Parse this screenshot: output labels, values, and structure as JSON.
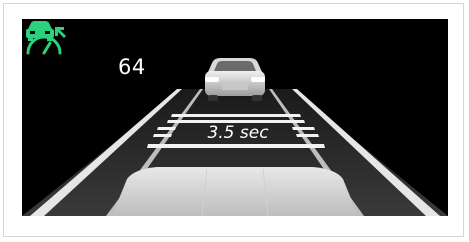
{
  "cruise": {
    "set_speed": "64",
    "icon": "adaptive-cruise-control-icon",
    "icon_color": "#2bd17e"
  },
  "following_distance": {
    "label": "3.5 sec"
  },
  "scene": {
    "lead_vehicle": "lead-car-icon",
    "own_vehicle": "ego-car-hood"
  },
  "colors": {
    "background": "#000000",
    "accent": "#2bd17e",
    "text": "#ffffff"
  }
}
